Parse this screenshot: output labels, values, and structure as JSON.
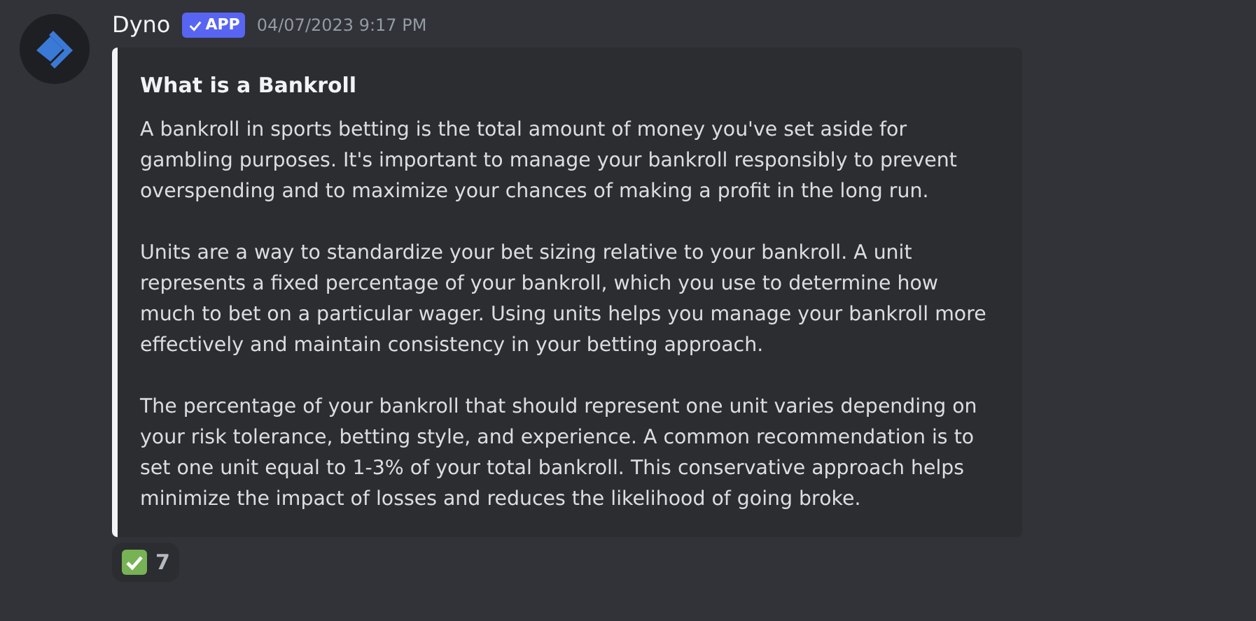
{
  "message": {
    "author": "Dyno",
    "badge": "APP",
    "timestamp": "04/07/2023 9:17 PM"
  },
  "embed": {
    "title": "What is a Bankroll",
    "paragraphs": [
      "A bankroll in sports betting is the total amount of money you've set aside for gambling purposes. It's important to manage your bankroll responsibly to prevent overspending and to maximize your chances of making a profit in the long run.",
      "Units are a way to standardize your bet sizing relative to your bankroll. A unit represents a fixed percentage of your bankroll, which you use to determine how much to bet on a particular wager. Using units helps you manage your bankroll more effectively and maintain consistency in your betting approach.",
      "The percentage of your bankroll that should represent one unit varies depending on your risk tolerance, betting style, and experience. A common recommendation is to set one unit equal to 1-3% of your total bankroll. This conservative approach helps minimize the impact of losses and reduces the likelihood of going broke."
    ]
  },
  "reactions": [
    {
      "count": "7"
    }
  ]
}
